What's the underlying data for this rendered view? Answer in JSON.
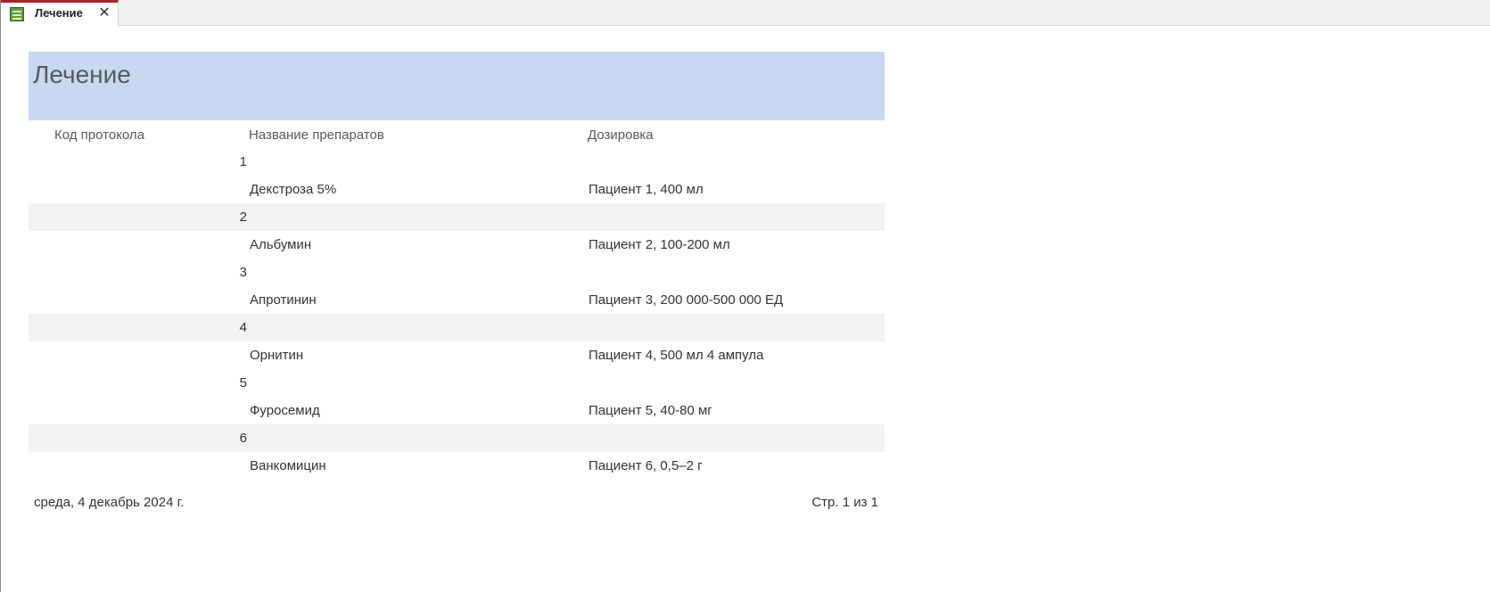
{
  "tab": {
    "label": "Лечение",
    "icon": "report-icon",
    "close_icon": "close-icon"
  },
  "report": {
    "title": "Лечение",
    "columns": {
      "code": "Код протокола",
      "name": "Название препаратов",
      "dose": "Дозировка"
    },
    "groups": [
      {
        "code": "1",
        "name": "Декстроза 5%",
        "dose": "Пациент 1, 400 мл"
      },
      {
        "code": "2",
        "name": "Альбумин",
        "dose": "Пациент 2, 100-200 мл"
      },
      {
        "code": "3",
        "name": "Апротинин",
        "dose": "Пациент 3, 200 000-500 000 ЕД"
      },
      {
        "code": "4",
        "name": "Орнитин",
        "dose": "Пациент 4, 500 мл 4 ампула"
      },
      {
        "code": "5",
        "name": "Фуросемид",
        "dose": "Пациент 5, 40-80 мг"
      },
      {
        "code": "6",
        "name": "Ванкомицин",
        "dose": "Пациент 6, 0,5–2 г"
      }
    ],
    "footer": {
      "date": "среда, 4 декабрь 2024 г.",
      "page": "Стр. 1 из 1"
    }
  },
  "colors": {
    "header_band": "#c6d9f1",
    "alt_row": "#f2f2f2",
    "tab_accent": "#a4262c"
  }
}
